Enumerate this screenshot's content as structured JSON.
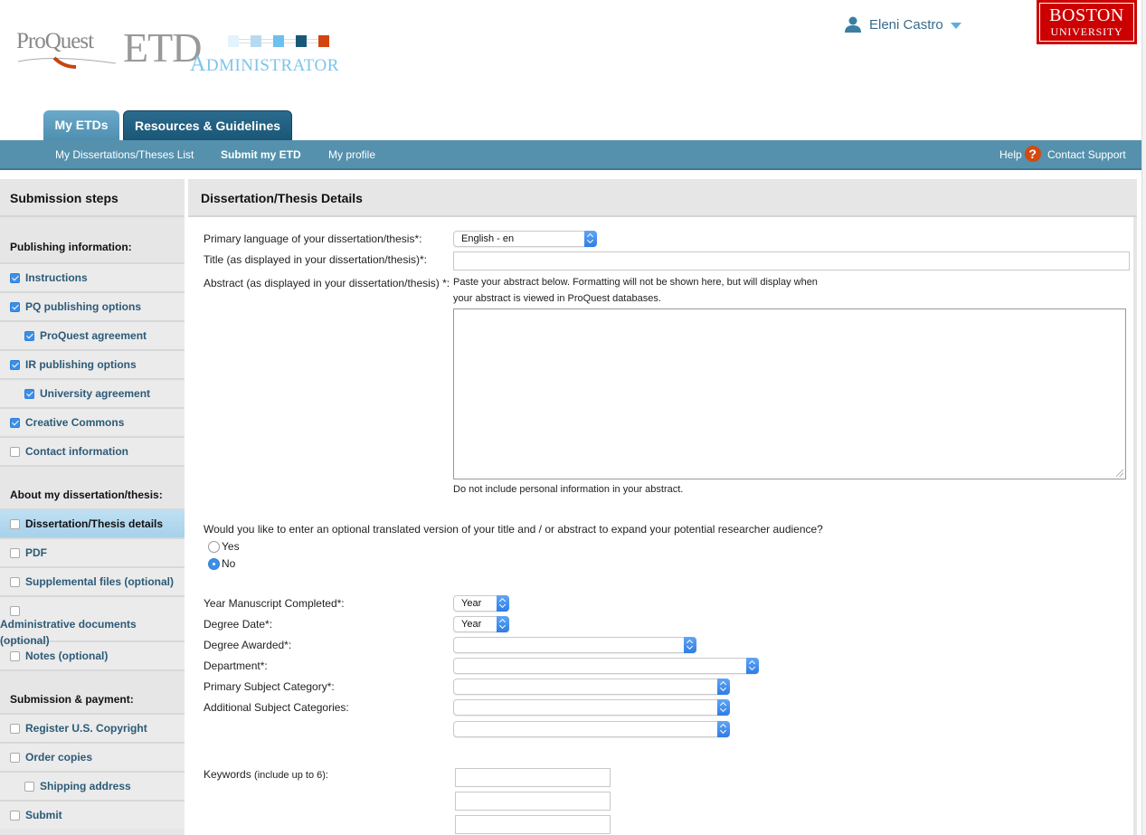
{
  "header": {
    "logo_proquest": "ProQuest",
    "logo_etd": "ETD",
    "logo_administrator": "Administrator",
    "user_name": "Eleni Castro",
    "university_line1": "BOSTON",
    "university_line2": "UNIVERSITY",
    "logo_colors": [
      "#e3f3fc",
      "#b6daf0",
      "#6cc0ef",
      "#1a5879",
      "#d2450e"
    ]
  },
  "tabs": [
    {
      "label": "My ETDs",
      "active": true
    },
    {
      "label": "Resources & Guidelines",
      "active": false
    }
  ],
  "subnav": {
    "items": [
      {
        "label": "My Dissertations/Theses List"
      },
      {
        "label": "Submit my ETD",
        "current": true
      },
      {
        "label": "My profile"
      }
    ],
    "help_label": "Help",
    "help_icon": "?",
    "contact_label": "Contact Support"
  },
  "sidebar": {
    "title": "Submission steps",
    "sections": [
      {
        "heading": "Publishing information:",
        "items": [
          {
            "label": "Instructions",
            "checked": true,
            "sub": false
          },
          {
            "label": "PQ publishing options",
            "checked": true,
            "sub": false
          },
          {
            "label": "ProQuest agreement",
            "checked": true,
            "sub": true
          },
          {
            "label": "IR publishing options",
            "checked": true,
            "sub": false
          },
          {
            "label": "University agreement",
            "checked": true,
            "sub": true
          },
          {
            "label": "Creative Commons",
            "checked": true,
            "sub": false
          },
          {
            "label": "Contact information",
            "checked": false,
            "sub": false
          }
        ]
      },
      {
        "heading": "About my dissertation/thesis:",
        "items": [
          {
            "label": "Dissertation/Thesis details",
            "checked": false,
            "sub": false,
            "active": true
          },
          {
            "label": "PDF",
            "checked": false,
            "sub": false
          },
          {
            "label": "Supplemental files (optional)",
            "checked": false,
            "sub": false
          },
          {
            "label": "Administrative documents (optional)",
            "checked": false,
            "sub": false
          },
          {
            "label": "Notes (optional)",
            "checked": false,
            "sub": false
          }
        ]
      },
      {
        "heading": "Submission & payment:",
        "items": [
          {
            "label": "Register U.S. Copyright",
            "checked": false,
            "sub": false
          },
          {
            "label": "Order copies",
            "checked": false,
            "sub": false
          },
          {
            "label": "Shipping address",
            "checked": false,
            "sub": true
          },
          {
            "label": "Submit",
            "checked": false,
            "sub": false
          }
        ]
      }
    ]
  },
  "main": {
    "title": "Dissertation/Thesis Details",
    "language_label": "Primary language of your dissertation/thesis*:",
    "language_value": "English - en",
    "title_label": "Title (as displayed in your dissertation/thesis)*:",
    "title_value": "",
    "abstract_label": "Abstract (as displayed in your dissertation/thesis) *:",
    "abstract_help_line1": "Paste your abstract below. Formatting will not be shown here, but will display when",
    "abstract_help_line2": "your abstract is viewed in ProQuest databases.",
    "abstract_value": "",
    "abstract_note": "Do not include personal information in your abstract.",
    "translation_question": "Would you like to enter an optional translated version of your title and / or abstract to expand your potential researcher audience?",
    "translation_options": [
      {
        "label": "Yes",
        "selected": false
      },
      {
        "label": "No",
        "selected": true
      }
    ],
    "year_completed_label": "Year Manuscript Completed*:",
    "year_completed_value": "Year",
    "degree_date_label": "Degree Date*:",
    "degree_date_value": "Year",
    "degree_awarded_label": "Degree Awarded*:",
    "degree_awarded_value": "",
    "department_label": "Department*:",
    "department_value": "",
    "primary_subject_label": "Primary Subject Category*:",
    "primary_subject_value": "",
    "additional_subjects_label": "Additional Subject Categories:",
    "additional_subjects_values": [
      "",
      ""
    ],
    "keywords_label": "Keywords",
    "keywords_hint": "(include up to 6):",
    "keywords_values": [
      "",
      "",
      ""
    ]
  }
}
